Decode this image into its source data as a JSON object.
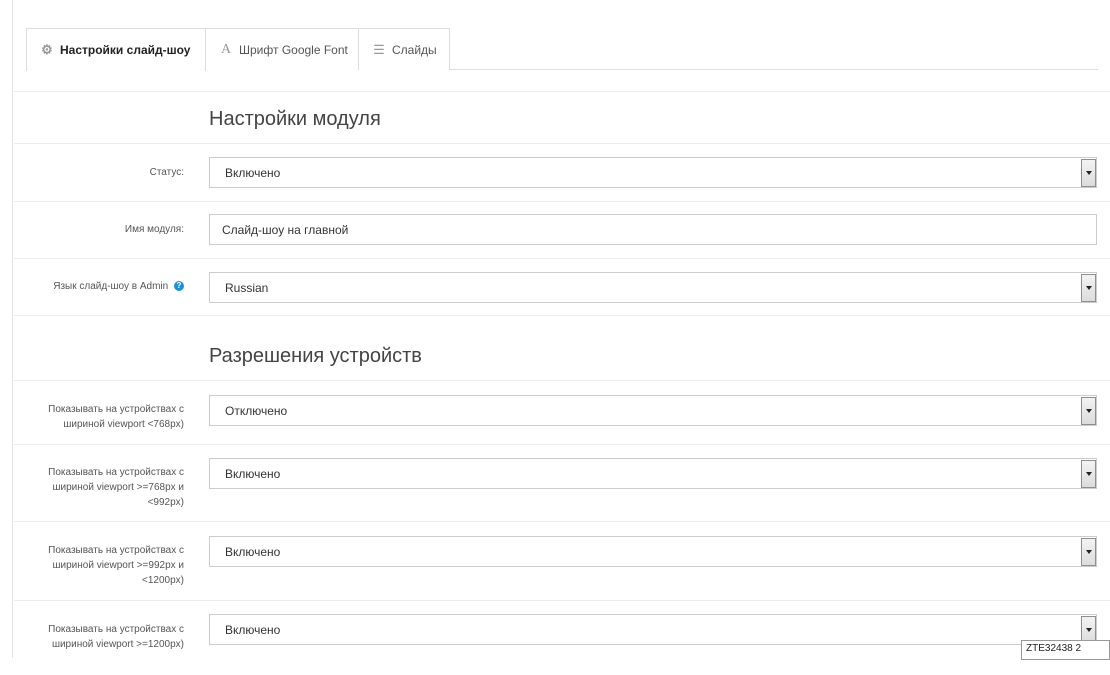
{
  "tabs": [
    {
      "label": "Настройки слайд-шоу",
      "icon": "gear-icon",
      "active": true
    },
    {
      "label": "Шрифт Google Font",
      "icon": "font-icon",
      "active": false
    },
    {
      "label": "Слайды",
      "icon": "list-icon",
      "active": false
    }
  ],
  "sections": {
    "module": "Настройки модуля",
    "devices": "Разрешения устройств"
  },
  "fields": {
    "status": {
      "label": "Статус:",
      "value": "Включено"
    },
    "module_name": {
      "label": "Имя модуля:",
      "value": "Слайд-шоу на главной"
    },
    "admin_language": {
      "label": "Язык слайд-шоу в Admin",
      "value": "Russian",
      "help_icon": "?"
    },
    "device_lt768": {
      "label_lines": [
        "Показывать на устройствах с",
        "шириной viewport <768px)"
      ],
      "value": "Отключено"
    },
    "device_768_992": {
      "label_lines": [
        "Показывать на устройствах с",
        "шириной viewport >=768px и",
        "<992px)"
      ],
      "value": "Включено"
    },
    "device_992_1200": {
      "label_lines": [
        "Показывать на устройствах с",
        "шириной viewport >=992px и",
        "<1200px)"
      ],
      "value": "Включено"
    },
    "device_gte1200": {
      "label_lines": [
        "Показывать на устройствах с",
        "шириной viewport >=1200px)"
      ],
      "value": "Включено"
    }
  },
  "tooltip": {
    "text": "ZTE32438 2"
  }
}
